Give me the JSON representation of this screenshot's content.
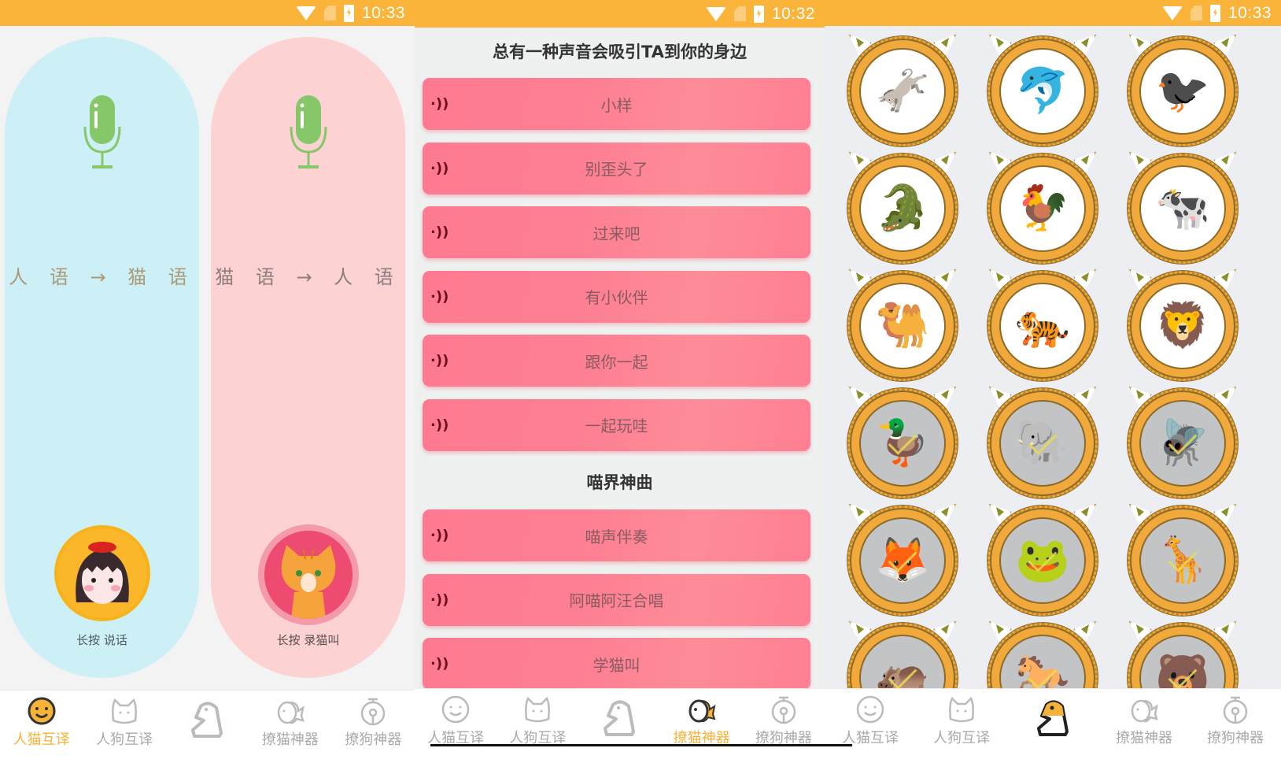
{
  "screens": [
    {
      "status": {
        "time": "10:33",
        "icons": [
          "wifi-icon",
          "no-sim-icon",
          "battery-charging-icon"
        ]
      },
      "panels": [
        {
          "title": "人 语 → 猫 语",
          "icon": "microphone-icon",
          "avatar": "girl-avatar",
          "hint": "长按 说话"
        },
        {
          "title": "猫 语 → 人 语",
          "icon": "microphone-icon",
          "avatar": "cat-avatar",
          "hint": "长按 录猫叫"
        }
      ],
      "active_tab": 0
    },
    {
      "status": {
        "time": "10:32",
        "icons": [
          "wifi-icon",
          "no-sim-icon",
          "battery-charging-icon"
        ]
      },
      "section1_title": "总有一种声音会吸引TA到你的身边",
      "section1_items": [
        "小样",
        "别歪头了",
        "过来吧",
        "有小伙伴",
        "跟你一起",
        "一起玩哇"
      ],
      "section2_title": "喵界神曲",
      "section2_items": [
        "喵声伴奏",
        "阿喵阿汪合唱",
        "学猫叫"
      ],
      "sound_icon": "·))",
      "active_tab": 3
    },
    {
      "status": {
        "time": "10:33",
        "icons": [
          "wifi-icon",
          "no-sim-icon",
          "battery-charging-icon"
        ]
      },
      "animals": [
        {
          "name": "donkey",
          "glyph": "🫏",
          "completed": false
        },
        {
          "name": "dolphin",
          "glyph": "🐬",
          "completed": false
        },
        {
          "name": "crow",
          "glyph": "🐦‍⬛",
          "completed": false
        },
        {
          "name": "crocodile",
          "glyph": "🐊",
          "completed": false
        },
        {
          "name": "rooster",
          "glyph": "🐓",
          "completed": false
        },
        {
          "name": "cow",
          "glyph": "🐄",
          "completed": false
        },
        {
          "name": "camel",
          "glyph": "🐫",
          "completed": false
        },
        {
          "name": "tiger",
          "glyph": "🐅",
          "completed": false
        },
        {
          "name": "lion",
          "glyph": "🦁",
          "completed": false
        },
        {
          "name": "duck",
          "glyph": "🦆",
          "completed": true
        },
        {
          "name": "elephant",
          "glyph": "🐘",
          "completed": true
        },
        {
          "name": "fly",
          "glyph": "🪰",
          "completed": true
        },
        {
          "name": "fox",
          "glyph": "🦊",
          "completed": true
        },
        {
          "name": "frog",
          "glyph": "🐸",
          "completed": true
        },
        {
          "name": "giraffe",
          "glyph": "🦒",
          "completed": true
        },
        {
          "name": "hippo",
          "glyph": "🦛",
          "completed": true
        },
        {
          "name": "horse",
          "glyph": "🐎",
          "completed": true
        },
        {
          "name": "bear",
          "glyph": "🐻",
          "completed": true
        }
      ],
      "active_tab": 2
    }
  ],
  "nav": {
    "tabs": [
      {
        "label": "人猫互译",
        "icon": "smiley-face-icon"
      },
      {
        "label": "人狗互译",
        "icon": "cat-face-icon"
      },
      {
        "label": "",
        "icon": "horse-chess-icon"
      },
      {
        "label": "撩猫神器",
        "icon": "fish-icon"
      },
      {
        "label": "撩狗神器",
        "icon": "bell-icon"
      }
    ]
  },
  "colors": {
    "accent": "#fbb43a",
    "active_label": "#f7b23a",
    "inactive": "#aaaaaa",
    "sound_button": "#fe7a90"
  }
}
